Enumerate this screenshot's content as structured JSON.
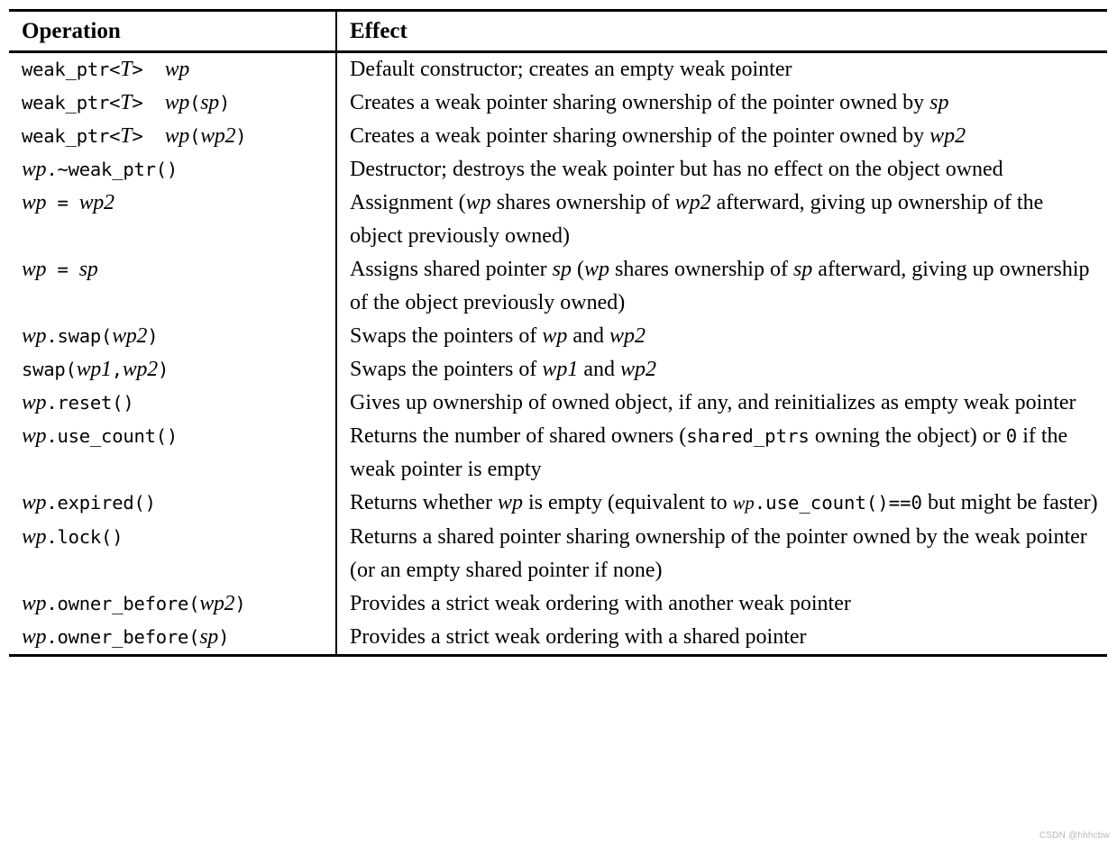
{
  "table": {
    "columns": [
      {
        "key": "operation",
        "header": "Operation"
      },
      {
        "key": "effect",
        "header": "Effect"
      }
    ],
    "rows": [
      {
        "operation": "weak_ptr<T> wp",
        "effect": "Default constructor; creates an empty weak pointer"
      },
      {
        "operation": "weak_ptr<T> wp(sp)",
        "effect": "Creates a weak pointer sharing ownership of the pointer owned by sp"
      },
      {
        "operation": "weak_ptr<T> wp(wp2)",
        "effect": "Creates a weak pointer sharing ownership of the pointer owned by wp2"
      },
      {
        "operation": "wp.~weak_ptr()",
        "effect": "Destructor; destroys the weak pointer but has no effect on the object owned"
      },
      {
        "operation": "wp = wp2",
        "effect": "Assignment (wp shares ownership of wp2 afterward, giving up ownership of the object previously owned)"
      },
      {
        "operation": "wp = sp",
        "effect": "Assigns shared pointer sp (wp shares ownership of sp afterward, giving up ownership of the object previously owned)"
      },
      {
        "operation": "wp.swap(wp2)",
        "effect": "Swaps the pointers of wp and wp2"
      },
      {
        "operation": "swap(wp1,wp2)",
        "effect": "Swaps the pointers of wp1 and wp2"
      },
      {
        "operation": "wp.reset()",
        "effect": "Gives up ownership of owned object, if any, and reinitializes as empty weak pointer"
      },
      {
        "operation": "wp.use_count()",
        "effect": "Returns the number of shared owners (shared_ptrs owning the object) or 0 if the weak pointer is empty"
      },
      {
        "operation": "wp.expired()",
        "effect": "Returns whether wp is empty (equivalent to wp.use_count()==0 but might be faster)"
      },
      {
        "operation": "wp.lock()",
        "effect": "Returns a shared pointer sharing ownership of the pointer owned by the weak pointer (or an empty shared pointer if none)"
      },
      {
        "operation": "wp.owner_before(wp2)",
        "effect": "Provides a strict weak ordering with another weak pointer"
      },
      {
        "operation": "wp.owner_before(sp)",
        "effect": "Provides a strict weak ordering with a shared pointer"
      }
    ]
  },
  "watermark": {
    "text": "CSDN @hhhcbw"
  },
  "colors": {
    "text": "#000000",
    "rule": "#000000",
    "background": "#ffffff",
    "watermark": "#b8b8b8"
  }
}
